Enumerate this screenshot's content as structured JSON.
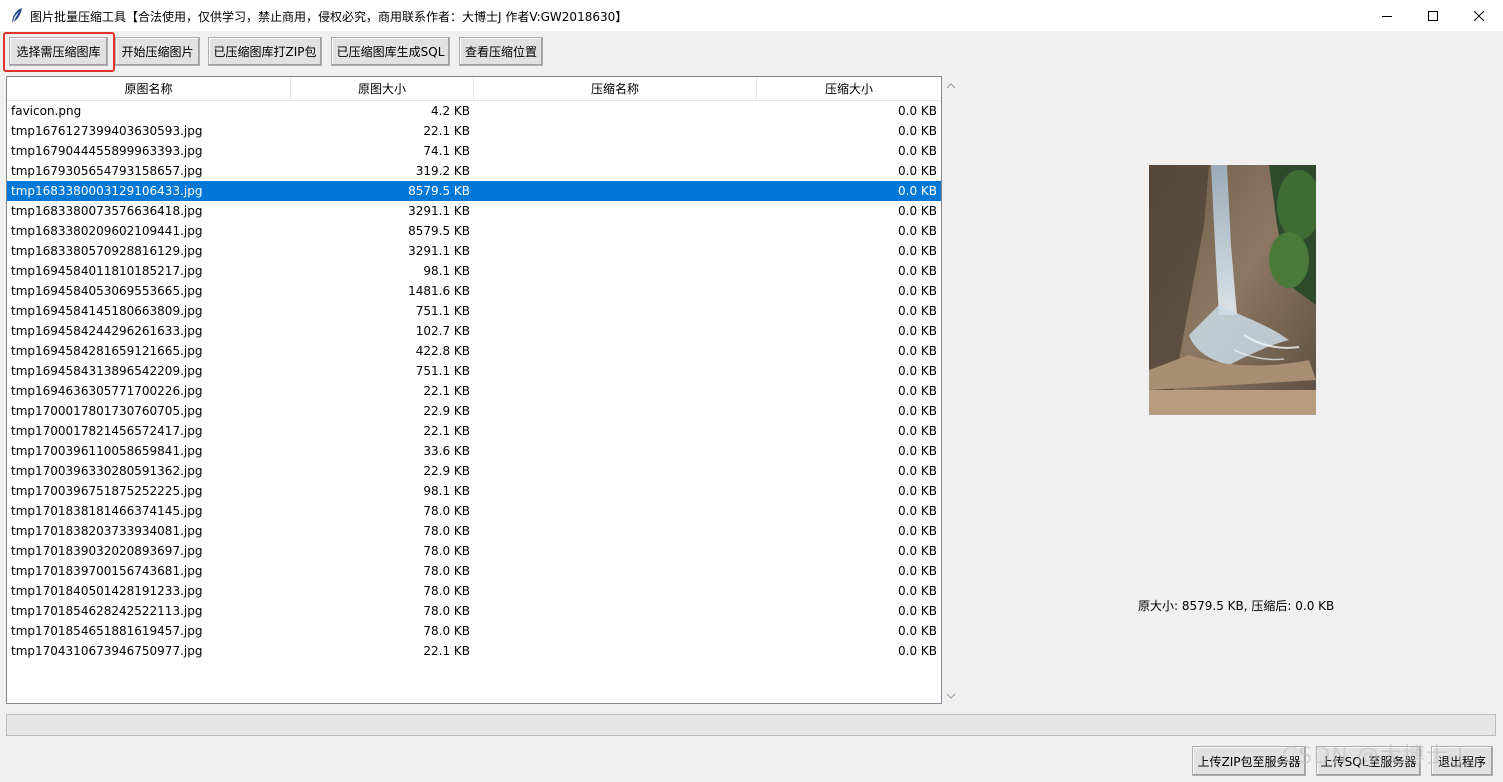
{
  "window": {
    "title": "图片批量压缩工具【合法使用，仅供学习，禁止商用，侵权必究，商用联系作者：大博士J 作者V:GW2018630】"
  },
  "toolbar": {
    "select_library": "选择需压缩图库",
    "start_compress": "开始压缩图片",
    "zip_compressed": "已压缩图库打ZIP包",
    "generate_sql": "已压缩图库生成SQL",
    "view_location": "查看压缩位置"
  },
  "table": {
    "columns": [
      "原图名称",
      "原图大小",
      "压缩名称",
      "压缩大小"
    ],
    "selected_index": 4,
    "rows": [
      {
        "name": "favicon.png",
        "size": "4.2 KB",
        "cname": "",
        "csize": "0.0 KB"
      },
      {
        "name": "tmp1676127399403630593.jpg",
        "size": "22.1 KB",
        "cname": "",
        "csize": "0.0 KB"
      },
      {
        "name": "tmp1679044455899963393.jpg",
        "size": "74.1 KB",
        "cname": "",
        "csize": "0.0 KB"
      },
      {
        "name": "tmp1679305654793158657.jpg",
        "size": "319.2 KB",
        "cname": "",
        "csize": "0.0 KB"
      },
      {
        "name": "tmp1683380003129106433.jpg",
        "size": "8579.5 KB",
        "cname": "",
        "csize": "0.0 KB"
      },
      {
        "name": "tmp1683380073576636418.jpg",
        "size": "3291.1 KB",
        "cname": "",
        "csize": "0.0 KB"
      },
      {
        "name": "tmp1683380209602109441.jpg",
        "size": "8579.5 KB",
        "cname": "",
        "csize": "0.0 KB"
      },
      {
        "name": "tmp1683380570928816129.jpg",
        "size": "3291.1 KB",
        "cname": "",
        "csize": "0.0 KB"
      },
      {
        "name": "tmp1694584011810185217.jpg",
        "size": "98.1 KB",
        "cname": "",
        "csize": "0.0 KB"
      },
      {
        "name": "tmp1694584053069553665.jpg",
        "size": "1481.6 KB",
        "cname": "",
        "csize": "0.0 KB"
      },
      {
        "name": "tmp1694584145180663809.jpg",
        "size": "751.1 KB",
        "cname": "",
        "csize": "0.0 KB"
      },
      {
        "name": "tmp1694584244296261633.jpg",
        "size": "102.7 KB",
        "cname": "",
        "csize": "0.0 KB"
      },
      {
        "name": "tmp1694584281659121665.jpg",
        "size": "422.8 KB",
        "cname": "",
        "csize": "0.0 KB"
      },
      {
        "name": "tmp1694584313896542209.jpg",
        "size": "751.1 KB",
        "cname": "",
        "csize": "0.0 KB"
      },
      {
        "name": "tmp1694636305771700226.jpg",
        "size": "22.1 KB",
        "cname": "",
        "csize": "0.0 KB"
      },
      {
        "name": "tmp1700017801730760705.jpg",
        "size": "22.9 KB",
        "cname": "",
        "csize": "0.0 KB"
      },
      {
        "name": "tmp1700017821456572417.jpg",
        "size": "22.1 KB",
        "cname": "",
        "csize": "0.0 KB"
      },
      {
        "name": "tmp1700396110058659841.jpg",
        "size": "33.6 KB",
        "cname": "",
        "csize": "0.0 KB"
      },
      {
        "name": "tmp1700396330280591362.jpg",
        "size": "22.9 KB",
        "cname": "",
        "csize": "0.0 KB"
      },
      {
        "name": "tmp1700396751875252225.jpg",
        "size": "98.1 KB",
        "cname": "",
        "csize": "0.0 KB"
      },
      {
        "name": "tmp1701838181466374145.jpg",
        "size": "78.0 KB",
        "cname": "",
        "csize": "0.0 KB"
      },
      {
        "name": "tmp1701838203733934081.jpg",
        "size": "78.0 KB",
        "cname": "",
        "csize": "0.0 KB"
      },
      {
        "name": "tmp1701839032020893697.jpg",
        "size": "78.0 KB",
        "cname": "",
        "csize": "0.0 KB"
      },
      {
        "name": "tmp1701839700156743681.jpg",
        "size": "78.0 KB",
        "cname": "",
        "csize": "0.0 KB"
      },
      {
        "name": "tmp1701840501428191233.jpg",
        "size": "78.0 KB",
        "cname": "",
        "csize": "0.0 KB"
      },
      {
        "name": "tmp1701854628242522113.jpg",
        "size": "78.0 KB",
        "cname": "",
        "csize": "0.0 KB"
      },
      {
        "name": "tmp1701854651881619457.jpg",
        "size": "78.0 KB",
        "cname": "",
        "csize": "0.0 KB"
      },
      {
        "name": "tmp1704310673946750977.jpg",
        "size": "22.1 KB",
        "cname": "",
        "csize": "0.0 KB"
      }
    ]
  },
  "preview": {
    "info": "原大小: 8579.5 KB, 压缩后: 0.0 KB"
  },
  "bottom": {
    "upload_zip": "上传ZIP包至服务器",
    "upload_sql": "上传SQL至服务器",
    "exit": "退出程序"
  },
  "watermark": "CSDN @大博士.J",
  "colors": {
    "selection": "#0078d7",
    "highlight_border": "#e5312c"
  }
}
